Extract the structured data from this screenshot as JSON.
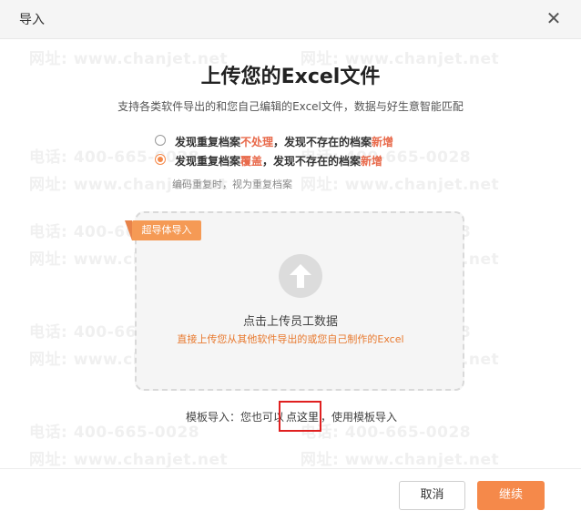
{
  "dialog": {
    "title": "导入",
    "close_icon": "close-icon"
  },
  "watermark": {
    "phone": "电话: 400-665-0028",
    "site": "网址: www.chanjet.net"
  },
  "main": {
    "heading": "上传您的Excel文件",
    "subheading": "支持各类软件导出的和您自己编辑的Excel文件，数据与好生意智能匹配",
    "options": [
      {
        "checked": false,
        "p1": "发现重复档案",
        "h1": "不处理",
        "p2": "，发现不存在的档案",
        "h2": "新增"
      },
      {
        "checked": true,
        "p1": "发现重复档案",
        "h1": "覆盖",
        "p2": "，发现不存在的档案",
        "h2": "新增"
      }
    ],
    "note": "编码重复时，视为重复档案",
    "dropzone": {
      "ribbon": "超导体导入",
      "icon": "upload-arrow-icon",
      "label": "点击上传员工数据",
      "sub": "直接上传您从其他软件导出的或您自己制作的Excel"
    },
    "template": {
      "prefix": "模板导入：您也可以",
      "link": "点这里",
      "suffix": "，使用模板导入"
    }
  },
  "footer": {
    "cancel": "取消",
    "continue": "继续"
  },
  "colors": {
    "accent": "#f5894a",
    "highlight": "#e8694a",
    "sub_orange": "#e8792e",
    "annotation_red": "#e02020"
  }
}
